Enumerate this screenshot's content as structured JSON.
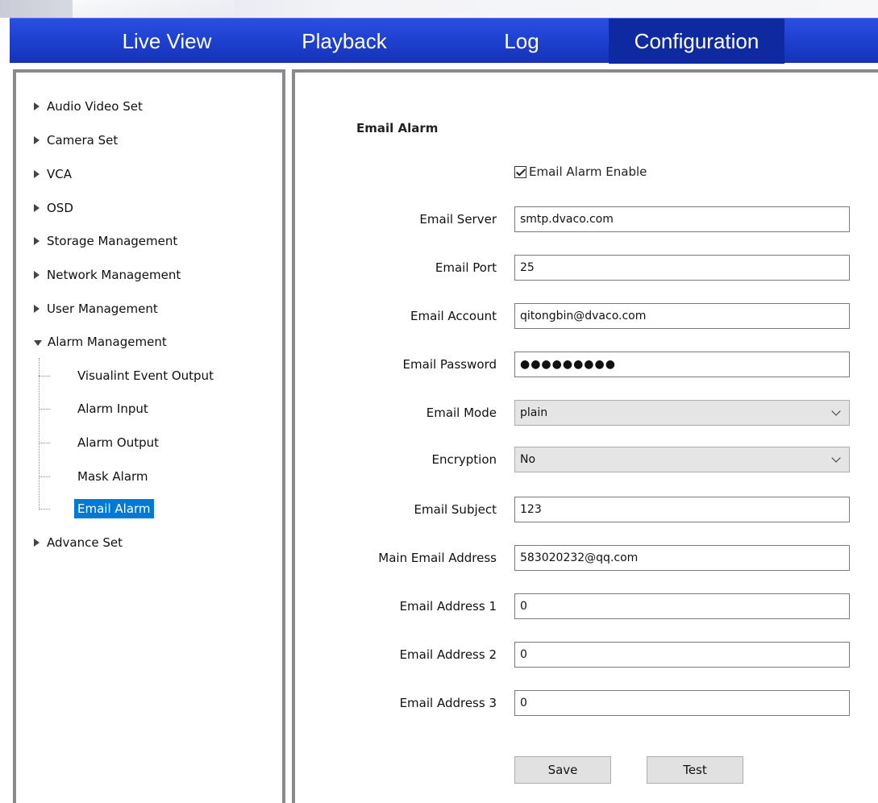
{
  "nav": {
    "tabs": [
      {
        "label": "Live View"
      },
      {
        "label": "Playback"
      },
      {
        "label": "Log"
      },
      {
        "label": "Configuration"
      }
    ],
    "active_tab": "Configuration"
  },
  "sidebar": {
    "items": [
      {
        "label": "Audio Video Set"
      },
      {
        "label": "Camera Set"
      },
      {
        "label": "VCA"
      },
      {
        "label": "OSD"
      },
      {
        "label": "Storage Management"
      },
      {
        "label": "Network Management"
      },
      {
        "label": "User Management"
      },
      {
        "label": "Alarm Management"
      },
      {
        "label": "Advance Set"
      }
    ],
    "alarm_children": [
      {
        "label": "Visualint Event Output"
      },
      {
        "label": "Alarm Input"
      },
      {
        "label": "Alarm Output"
      },
      {
        "label": "Mask Alarm"
      },
      {
        "label": "Email Alarm"
      }
    ],
    "selected": "Email Alarm"
  },
  "form": {
    "title": "Email Alarm",
    "enable_label": "Email Alarm Enable",
    "enable_checked": true,
    "fields": {
      "server": {
        "label": "Email Server",
        "value": "smtp.dvaco.com"
      },
      "port": {
        "label": "Email Port",
        "value": "25"
      },
      "account": {
        "label": "Email Account",
        "value": "qitongbin@dvaco.com"
      },
      "password": {
        "label": "Email Password",
        "value": "●●●●●●●●●"
      },
      "mode": {
        "label": "Email Mode",
        "value": "plain"
      },
      "encryption": {
        "label": "Encryption",
        "value": "No"
      },
      "subject": {
        "label": "Email Subject",
        "value": "123"
      },
      "main_address": {
        "label": "Main Email Address",
        "value": "583020232@qq.com"
      },
      "address1": {
        "label": "Email Address 1",
        "value": "0"
      },
      "address2": {
        "label": "Email Address 2",
        "value": "0"
      },
      "address3": {
        "label": "Email Address 3",
        "value": "0"
      }
    },
    "save_label": "Save",
    "test_label": "Test"
  },
  "colors": {
    "nav_blue": "#1e40d0",
    "nav_active": "#0f2aa0",
    "selection_blue": "#0078d7",
    "panel_border": "#888a8e"
  }
}
